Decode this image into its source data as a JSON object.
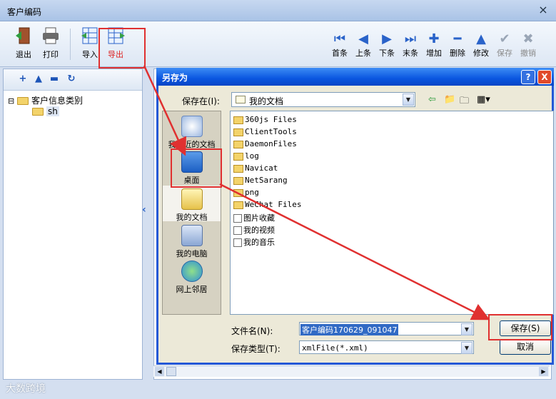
{
  "main_window": {
    "title": "客户编码",
    "close": "×"
  },
  "toolbar": {
    "left": [
      {
        "label": "退出",
        "icon": "exit-icon"
      },
      {
        "label": "打印",
        "icon": "printer-icon"
      },
      {
        "label": "导入",
        "icon": "import-icon"
      },
      {
        "label": "导出",
        "icon": "export-icon"
      }
    ],
    "right": [
      {
        "label": "首条",
        "icon": "first-icon",
        "glyph": "⏮"
      },
      {
        "label": "上条",
        "icon": "prev-icon",
        "glyph": "◀"
      },
      {
        "label": "下条",
        "icon": "next-icon",
        "glyph": "▶"
      },
      {
        "label": "末条",
        "icon": "last-icon",
        "glyph": "⏭"
      },
      {
        "label": "增加",
        "icon": "add-icon",
        "glyph": "✚"
      },
      {
        "label": "删除",
        "icon": "delete-icon",
        "glyph": "━"
      },
      {
        "label": "修改",
        "icon": "edit-icon",
        "glyph": "▲"
      },
      {
        "label": "保存",
        "icon": "save-icon",
        "glyph": "✔"
      },
      {
        "label": "撤销",
        "icon": "cancel-icon",
        "glyph": "✖"
      }
    ]
  },
  "tree": {
    "root": "客户信息类别",
    "child": "sh",
    "expander": "⊟",
    "tools": [
      "+",
      "▲",
      "▬",
      "↻"
    ]
  },
  "dialog": {
    "title": "另存为",
    "help": "?",
    "close": "X",
    "save_in_label": "保存在(I):",
    "save_in_value": "我的文档",
    "places": [
      "我最近的文档",
      "桌面",
      "我的文档",
      "我的电脑",
      "网上邻居"
    ],
    "files": [
      {
        "name": "360js Files",
        "type": "folder"
      },
      {
        "name": "ClientTools",
        "type": "folder"
      },
      {
        "name": "DaemonFiles",
        "type": "folder"
      },
      {
        "name": "log",
        "type": "folder"
      },
      {
        "name": "Navicat",
        "type": "folder"
      },
      {
        "name": "NetSarang",
        "type": "folder"
      },
      {
        "name": "png",
        "type": "folder"
      },
      {
        "name": "WeChat Files",
        "type": "folder"
      },
      {
        "name": "图片收藏",
        "type": "special"
      },
      {
        "name": "我的视频",
        "type": "special"
      },
      {
        "name": "我的音乐",
        "type": "special"
      }
    ],
    "filename_label": "文件名(N):",
    "filename_value": "客户编码170629_091047",
    "filetype_label": "保存类型(T):",
    "filetype_value": "xmlFile(*.xml)",
    "save_button": "保存(S)",
    "cancel_button": "取消"
  },
  "nav_collapse": "‹",
  "watermark": "大数跨境"
}
